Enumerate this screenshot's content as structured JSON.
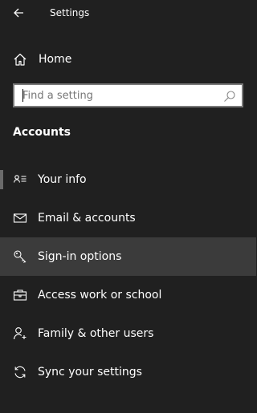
{
  "window": {
    "title": "Settings"
  },
  "home": {
    "label": "Home"
  },
  "search": {
    "placeholder": "Find a setting"
  },
  "section": {
    "title": "Accounts"
  },
  "nav": {
    "items": [
      {
        "label": "Your info",
        "icon": "contact-card-icon"
      },
      {
        "label": "Email & accounts",
        "icon": "mail-icon"
      },
      {
        "label": "Sign-in options",
        "icon": "key-icon",
        "selected": true
      },
      {
        "label": "Access work or school",
        "icon": "briefcase-icon"
      },
      {
        "label": "Family & other users",
        "icon": "add-user-icon"
      },
      {
        "label": "Sync your settings",
        "icon": "sync-icon"
      }
    ]
  },
  "colors": {
    "background": "#202020",
    "selected_row": "#3b3b3b",
    "text": "#ffffff",
    "search_border": "#7a7a7a"
  }
}
